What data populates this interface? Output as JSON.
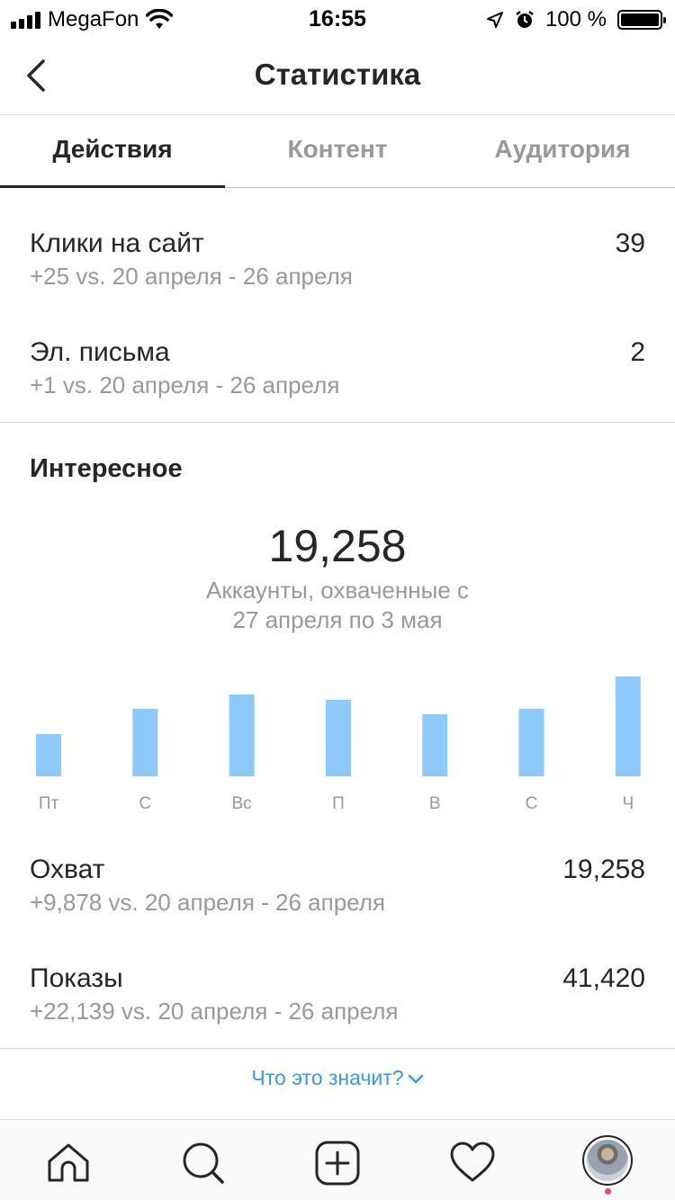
{
  "status_bar": {
    "carrier": "MegaFon",
    "time": "16:55",
    "battery": "100 %"
  },
  "nav": {
    "title": "Статистика",
    "back_icon": "chevron-left-icon"
  },
  "tabs": [
    {
      "label": "Действия",
      "active": true
    },
    {
      "label": "Контент",
      "active": false
    },
    {
      "label": "Аудитория",
      "active": false
    }
  ],
  "stats_top": [
    {
      "label": "Клики на сайт",
      "value": "39",
      "change": "+25 vs. 20 апреля - 26 апреля"
    },
    {
      "label": "Эл. письма",
      "value": "2",
      "change": "+1 vs. 20 апреля - 26 апреля"
    }
  ],
  "discovery": {
    "title": "Интересное",
    "big_number": "19,258",
    "caption_line1": "Аккаунты, охваченные с",
    "caption_line2": "27 апреля по 3 мая"
  },
  "chart_data": {
    "type": "bar",
    "categories": [
      "Пт",
      "С",
      "Вс",
      "П",
      "В",
      "С",
      "Ч"
    ],
    "values": [
      47,
      75,
      91,
      85,
      69,
      75,
      111
    ],
    "ylim": [
      0,
      120
    ],
    "color": "#8ec9fc",
    "grid": false
  },
  "stats_bottom": [
    {
      "label": "Охват",
      "value": "19,258",
      "change": "+9,878 vs. 20 апреля - 26 апреля"
    },
    {
      "label": "Показы",
      "value": "41,420",
      "change": "+22,139 vs. 20 апреля - 26 апреля"
    }
  ],
  "help_link": "Что это значит?",
  "tabbar": {
    "icons": [
      "home-icon",
      "search-icon",
      "new-post-icon",
      "activity-heart-icon",
      "profile-avatar"
    ],
    "notification_color": "#ed4956"
  },
  "colors": {
    "text": "#262626",
    "secondary": "#999999",
    "link": "#3897f0",
    "bar": "#8ec9fc"
  }
}
